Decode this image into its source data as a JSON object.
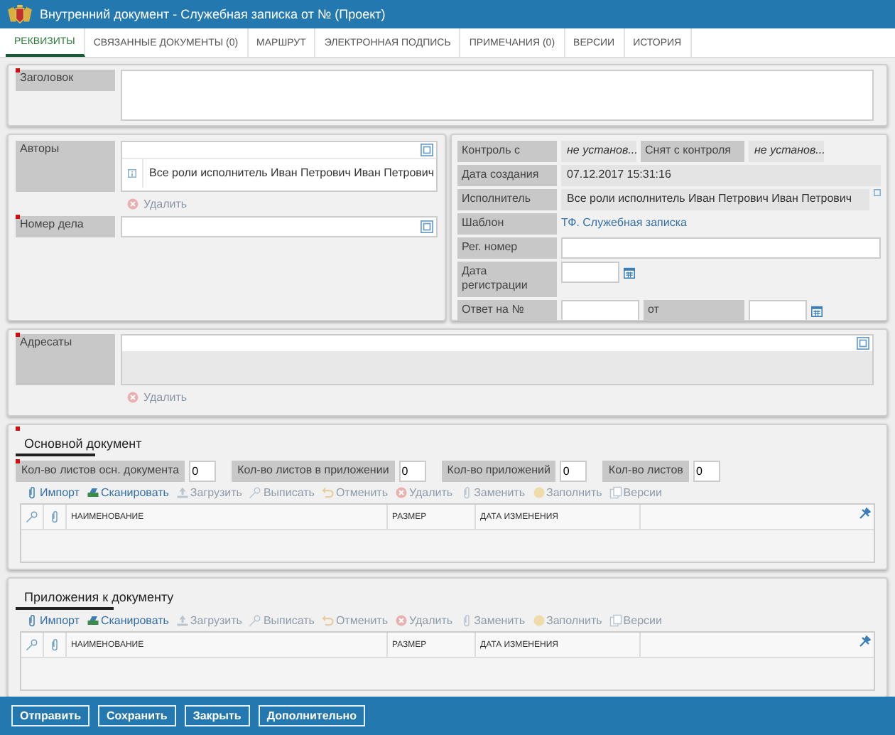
{
  "window": {
    "title": "Внутренний документ - Служебная записка от № (Проект)"
  },
  "tabs": [
    {
      "label": "РЕКВИЗИТЫ",
      "selected": true
    },
    {
      "label": "СВЯЗАННЫЕ ДОКУМЕНТЫ (0)",
      "selected": false
    },
    {
      "label": "МАРШРУТ",
      "selected": false
    },
    {
      "label": "ЭЛЕКТРОННАЯ ПОДПИСЬ",
      "selected": false
    },
    {
      "label": "ПРИМЕЧАНИЯ (0)",
      "selected": false
    },
    {
      "label": "ВЕРСИИ",
      "selected": false
    },
    {
      "label": "ИСТОРИЯ",
      "selected": false
    }
  ],
  "title_field": {
    "label": "Заголовок",
    "required": true
  },
  "authors": {
    "label": "Авторы",
    "required": false,
    "items": [
      "Все роли исполнитель Иван Петрович Иван Петрович"
    ],
    "delete_label": "Удалить"
  },
  "case_number": {
    "label": "Номер дела",
    "required": true
  },
  "control": {
    "from_label": "Контроль с",
    "from_value": "не установ...",
    "removed_label": "Снят с контроля",
    "removed_value": "не установ..."
  },
  "created": {
    "label": "Дата создания",
    "value": "07.12.2017 15:31:16"
  },
  "executor": {
    "label": "Исполнитель",
    "value": "Все роли исполнитель Иван Петрович Иван Петрович"
  },
  "template": {
    "label": "Шаблон",
    "value": "ТФ. Служебная записка"
  },
  "reg_number": {
    "label": "Рег. номер"
  },
  "reg_date": {
    "label": "Дата регистрации"
  },
  "reply_to": {
    "label": "Ответ на №",
    "from_label": "от"
  },
  "addressees": {
    "label": "Адресаты",
    "required": true,
    "delete_label": "Удалить"
  },
  "sections": [
    {
      "title": "Основной документ",
      "required": true,
      "counters": [
        {
          "label": "Кол-во листов осн. документа",
          "value": "0",
          "required": true
        },
        {
          "label": "Кол-во листов в приложении",
          "value": "0",
          "required": false
        },
        {
          "label": "Кол-во приложений",
          "value": "0",
          "required": false
        },
        {
          "label": "Кол-во листов",
          "value": "0",
          "required": false
        }
      ],
      "toolbar": [
        {
          "kind": "import",
          "label": "Импорт",
          "disabled": false
        },
        {
          "kind": "scan",
          "label": "Сканировать",
          "disabled": false
        },
        {
          "kind": "upload",
          "label": "Загрузить",
          "disabled": true
        },
        {
          "kind": "checkout",
          "label": "Выписать",
          "disabled": true
        },
        {
          "kind": "cancel",
          "label": "Отменить",
          "disabled": true
        },
        {
          "kind": "delete",
          "label": "Удалить",
          "disabled": true
        },
        {
          "kind": "replace",
          "label": "Заменить",
          "disabled": true
        },
        {
          "kind": "fill",
          "label": "Заполнить",
          "disabled": true
        },
        {
          "kind": "versions",
          "label": "Версии",
          "disabled": true
        }
      ],
      "columns": [
        "НАИМЕНОВАНИЕ",
        "РАЗМЕР",
        "ДАТА ИЗМЕНЕНИЯ"
      ]
    },
    {
      "title": "Приложения к документу",
      "required": false,
      "toolbar": [
        {
          "kind": "import",
          "label": "Импорт",
          "disabled": false
        },
        {
          "kind": "scan",
          "label": "Сканировать",
          "disabled": false
        },
        {
          "kind": "upload",
          "label": "Загрузить",
          "disabled": true
        },
        {
          "kind": "checkout",
          "label": "Выписать",
          "disabled": true
        },
        {
          "kind": "cancel",
          "label": "Отменить",
          "disabled": true
        },
        {
          "kind": "delete",
          "label": "Удалить",
          "disabled": true
        },
        {
          "kind": "replace",
          "label": "Заменить",
          "disabled": true
        },
        {
          "kind": "fill",
          "label": "Заполнить",
          "disabled": true
        },
        {
          "kind": "versions",
          "label": "Версии",
          "disabled": true
        }
      ],
      "columns": [
        "НАИМЕНОВАНИЕ",
        "РАЗМЕР",
        "ДАТА ИЗМЕНЕНИЯ"
      ]
    }
  ],
  "footer_buttons": [
    "Отправить",
    "Сохранить",
    "Закрыть",
    "Дополнительно"
  ]
}
